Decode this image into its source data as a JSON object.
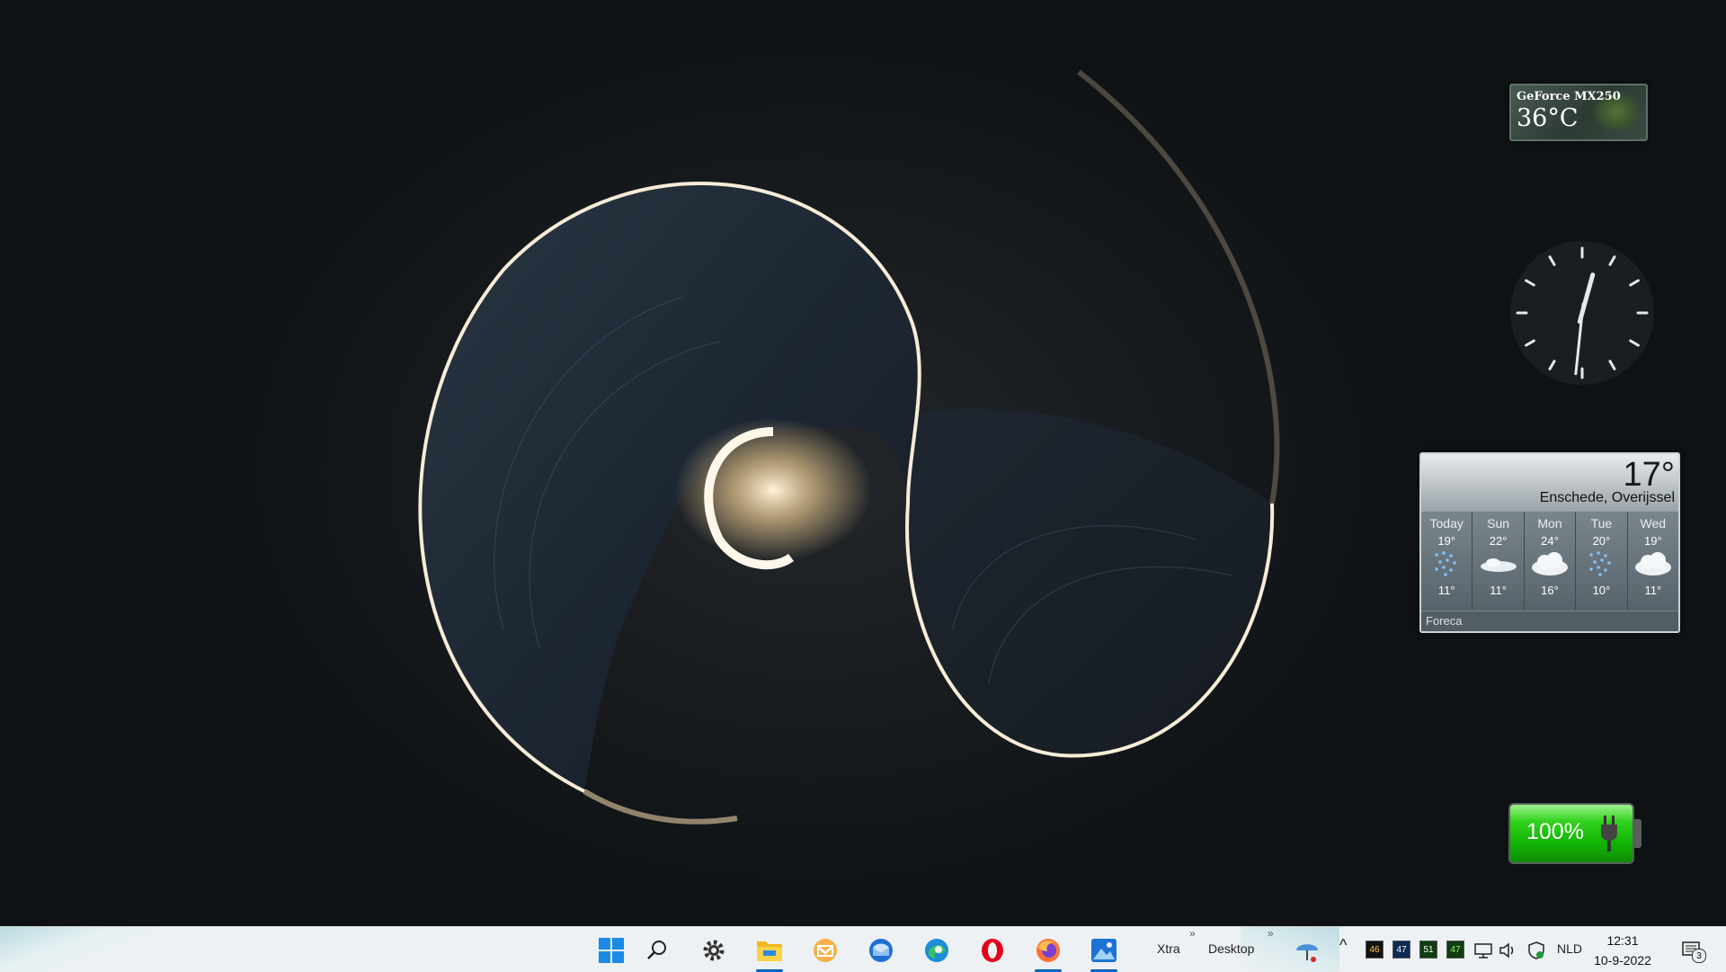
{
  "desktop": {
    "gpu_widget": {
      "name": "GeForce MX250",
      "temp": "36°C"
    },
    "clock_widget": {
      "hour": 12,
      "minute": 31
    },
    "weather_widget": {
      "current_temp": "17°",
      "location": "Enschede, Overijssel",
      "provider": "Foreca",
      "days": [
        {
          "name": "Today",
          "hi": "19°",
          "lo": "11°",
          "icon": "rain-icon"
        },
        {
          "name": "Sun",
          "hi": "22°",
          "lo": "11°",
          "icon": "partly-cloudy-icon"
        },
        {
          "name": "Mon",
          "hi": "24°",
          "lo": "16°",
          "icon": "cloud-icon"
        },
        {
          "name": "Tue",
          "hi": "20°",
          "lo": "10°",
          "icon": "rain-icon"
        },
        {
          "name": "Wed",
          "hi": "19°",
          "lo": "11°",
          "icon": "cloud-icon"
        }
      ]
    },
    "battery_widget": {
      "percent_label": "100%",
      "level": 1.0
    }
  },
  "taskbar": {
    "apps": [
      "start-icon",
      "search-icon",
      "settings-icon",
      "file-explorer-icon",
      "mail-icon",
      "thunderbird-icon",
      "edge-icon",
      "opera-icon",
      "firefox-icon",
      "photos-icon"
    ],
    "toolbars": {
      "xtra": "Xtra",
      "desktop": "Desktop"
    },
    "tray": {
      "temps": [
        "46",
        "47",
        "51",
        "47"
      ],
      "language": "NLD",
      "time": "12:31",
      "date": "10-9-2022",
      "notifications": "3"
    },
    "colors": {
      "accent": "#0a64c8"
    }
  }
}
